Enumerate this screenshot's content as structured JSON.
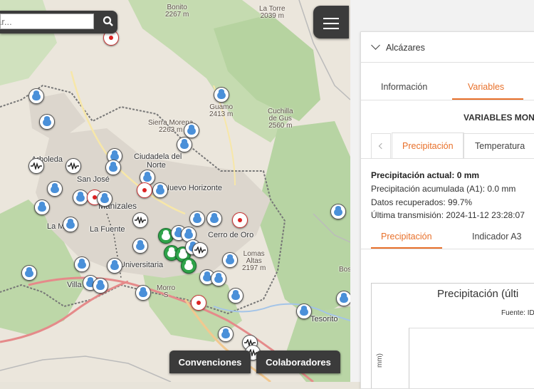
{
  "map": {
    "search_placeholder": "ar...",
    "places": {
      "bonito": "Bonito",
      "bonito_alt": "2267 m",
      "latorre": "La Torre",
      "latorre_alt": "2039 m",
      "guamo": "Guamo",
      "guamo_alt": "2413 m",
      "cuchilla": "Cuchilla",
      "cuchilla2": "de Gus",
      "cuchilla_alt": "2560 m",
      "sierra": "Sierra Morena",
      "sierra_alt": "2263 m",
      "lomas": "Lomas",
      "lomas2": "Altas",
      "lomas_alt": "2197 m",
      "bosque": "Bosq",
      "morro": "Morro",
      "morro2": "S"
    },
    "cities": {
      "ciudadela": "Ciudadela del",
      "ciudadela2": "Norte",
      "nuevo": "Nuevo Horizonte",
      "sanjose": "San José",
      "manizales": "Manizales",
      "lafuente": "La Fuente",
      "cerro": "Cerro de Oro",
      "lamac": "La Mac",
      "universitaria": "Universitaria",
      "villa": "Villa",
      "tesorito": "Tesorito",
      "arboleda": "Arboleda"
    },
    "buttons": {
      "convenciones": "Convenciones",
      "colaboradores": "Colaboradores"
    }
  },
  "panel": {
    "station": "Alcázares",
    "tabs": [
      "Información",
      "Variables"
    ],
    "section_title": "VARIABLES MON",
    "var_tabs": [
      "Precipitación",
      "Temperatura"
    ],
    "current": "Precipitación actual: 0 mm",
    "accumulated": "Precipitación acumulada (A1): 0.0 mm",
    "recovered": "Datos recuperados: 99.7%",
    "last_tx": "Última transmisión: 2024-11-12 23:28:07",
    "sub_tabs": [
      "Precipitación",
      "Indicador A3"
    ],
    "chart_title": "Precipitación (últi",
    "chart_source": "Fuente: ID",
    "chart_ylabel": "mm)"
  },
  "colors": {
    "accent": "#e8702a",
    "dark_control": "#3b3b3b"
  }
}
